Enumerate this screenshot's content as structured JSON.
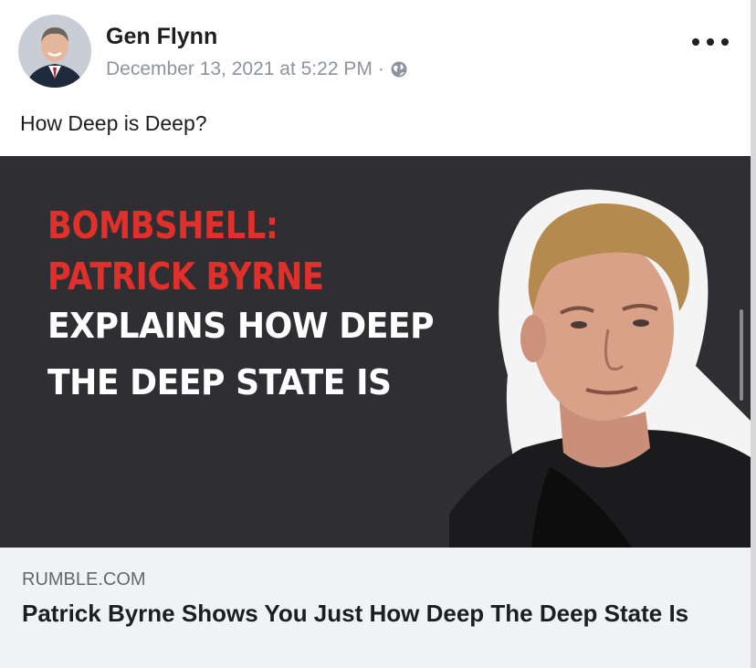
{
  "post": {
    "author": "Gen Flynn",
    "timestamp": "December 13, 2021 at 5:22 PM",
    "separator": "·",
    "privacy_icon": "globe-icon",
    "more_icon": "more-options-icon",
    "caption": "How Deep is Deep?"
  },
  "media": {
    "lines": [
      {
        "text": "BOMBSHELL:",
        "color": "#e0302b"
      },
      {
        "text": "PATRICK BYRNE",
        "color": "#e0302b"
      },
      {
        "text": "EXPLAINS HOW DEEP",
        "color": "#ffffff"
      },
      {
        "text": "THE DEEP STATE IS",
        "color": "#ffffff"
      }
    ],
    "background": "#2f2e32"
  },
  "link": {
    "domain": "RUMBLE.COM",
    "title": "Patrick Byrne Shows You Just How Deep The Deep State Is"
  }
}
